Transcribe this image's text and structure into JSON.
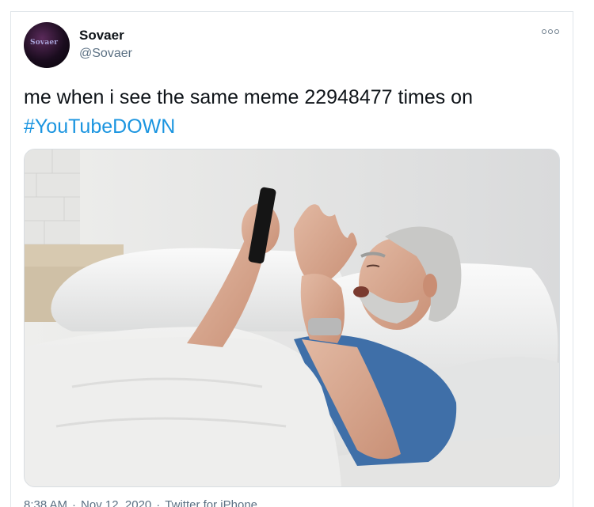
{
  "tweet": {
    "author": {
      "display_name": "Sovaer",
      "handle": "@Sovaer",
      "avatar_text": "Sovaer"
    },
    "more_icon": "more-options-icon",
    "text": "me when i see the same meme 22948477 times on",
    "hashtag": "#YouTubeDOWN",
    "media": {
      "icon": "photo-old-man-in-bed-with-phone"
    },
    "footer": {
      "time": "8:38 AM",
      "date": "Nov 12, 2020",
      "separator": "·",
      "source": "Twitter for iPhone"
    }
  },
  "colors": {
    "link": "#1b95e0",
    "text": "#0f1419",
    "secondary": "#5b7083",
    "border": "#e1e6ea"
  }
}
